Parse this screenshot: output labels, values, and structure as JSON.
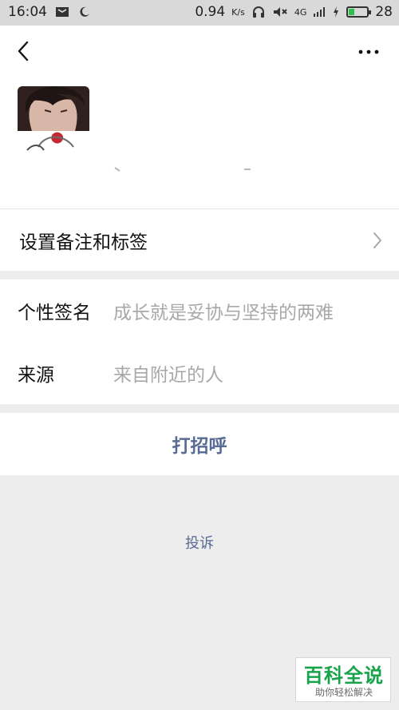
{
  "status_bar": {
    "time": "16:04",
    "network_speed": "0.94",
    "network_unit": "K/s",
    "signal_label": "4G",
    "battery_level": "28"
  },
  "profile": {
    "remark_row_label": "设置备注和标签",
    "signature_label": "个性签名",
    "signature_value": "成长就是妥协与坚持的两难",
    "source_label": "来源",
    "source_value": "来自附近的人",
    "greet_button": "打招呼",
    "report_link": "投诉"
  },
  "watermark": {
    "title": "百科全说",
    "subtitle": "助你轻松解决"
  },
  "colors": {
    "background": "#ededed",
    "card": "#ffffff",
    "link_blue": "#576b95",
    "muted_text": "#a8a8a8",
    "battery_green": "#2fbf4a",
    "watermark_green": "#17a34a"
  },
  "icons": [
    "sim-card-icon",
    "moon-icon",
    "headphones-icon",
    "mute-icon",
    "signal-icon",
    "charging-icon",
    "battery-icon",
    "back-arrow-icon",
    "more-icon",
    "chevron-right-icon"
  ]
}
